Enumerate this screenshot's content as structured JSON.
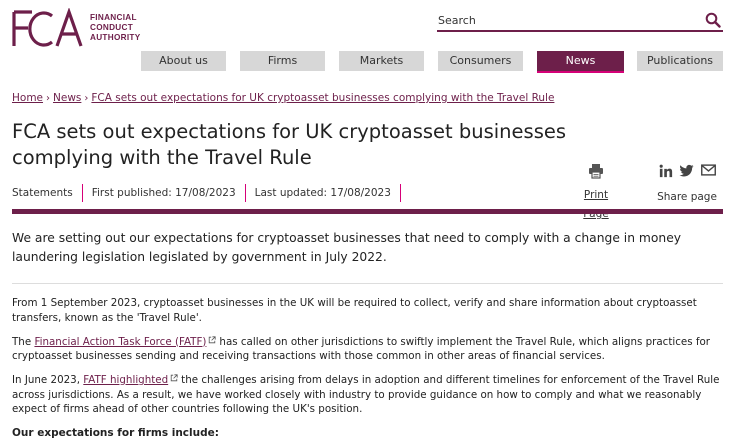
{
  "logo": {
    "mark": "FCA",
    "line1": "FINANCIAL",
    "line2": "CONDUCT",
    "line3": "AUTHORITY"
  },
  "search": {
    "placeholder": "Search",
    "icon": "search-icon"
  },
  "nav": {
    "items": [
      {
        "label": "About us"
      },
      {
        "label": "Firms"
      },
      {
        "label": "Markets"
      },
      {
        "label": "Consumers"
      },
      {
        "label": "News"
      },
      {
        "label": "Publications"
      }
    ],
    "active": "News"
  },
  "breadcrumb": {
    "items": [
      "Home",
      "News",
      "FCA sets out expectations for UK cryptoasset businesses complying with the Travel Rule"
    ]
  },
  "article": {
    "title": "FCA sets out expectations for UK cryptoasset businesses complying with the Travel Rule",
    "type": "Statements",
    "first_published": "First published: 17/08/2023",
    "last_updated": "Last updated: 17/08/2023",
    "lead": "We are setting out our expectations for cryptoasset businesses that need to comply with a change in money laundering legislation legislated by government in July 2022.",
    "para1": "From 1 September 2023, cryptoasset businesses in the UK will be required to collect, verify and share information about cryptoasset transfers, known as the 'Travel Rule'.",
    "para2_prefix": "The ",
    "para2_link": "Financial Action Task Force (FATF)",
    "para2_suffix": "has called on other jurisdictions to swiftly implement the Travel Rule, which aligns practices for cryptoasset businesses sending and receiving transactions with those common in other areas of financial services.",
    "para3_prefix": "In June 2023, ",
    "para3_link": "FATF highlighted",
    "para3_suffix": "the challenges arising from delays in adoption and different timelines for enforcement of the Travel Rule across jurisdictions. As a result, we have worked closely with industry to provide guidance on how to comply and what we reasonably expect of firms ahead of other countries following the UK's position.",
    "subheading": "Our expectations for firms include:"
  },
  "tools": {
    "print_label": "Print Page",
    "share_label": "Share page"
  },
  "colors": {
    "brand": "#6d1f4a",
    "accent": "#d60078",
    "nav_bg": "#d7d7d7"
  }
}
